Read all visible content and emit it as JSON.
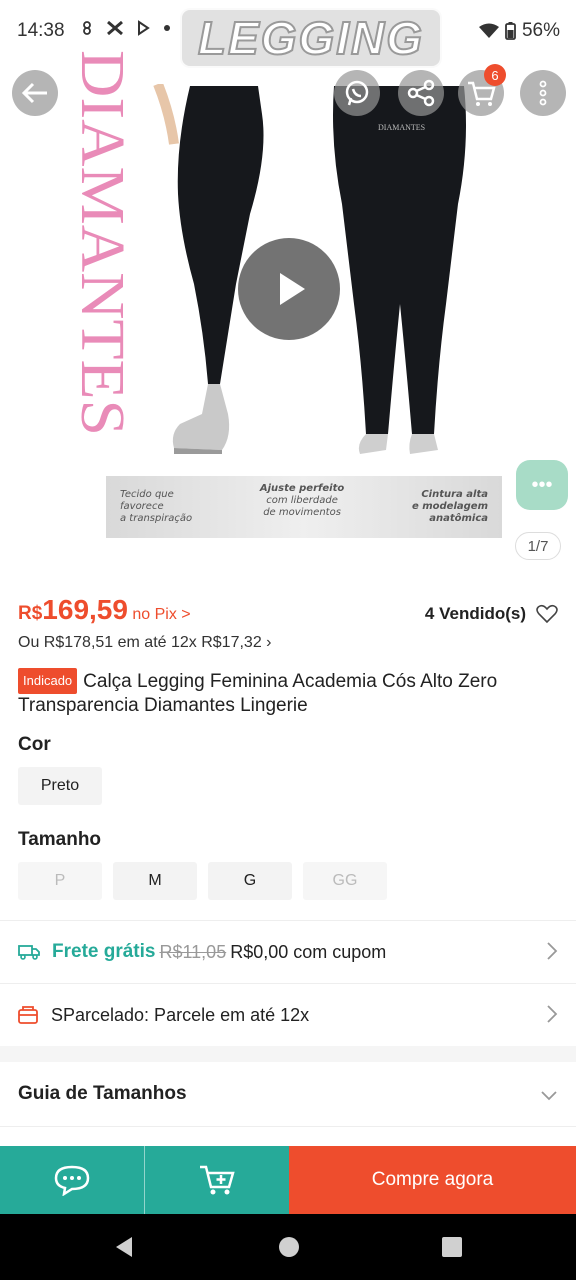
{
  "status_bar": {
    "time": "14:38",
    "battery": "56%",
    "watermark": "LEGGING"
  },
  "media": {
    "brand_text": "DIAMANTES",
    "back_waistband_text": "DIAMANTES",
    "banner": {
      "left": [
        "Tecido que",
        "favorece",
        "a transpiração"
      ],
      "middle": [
        "Ajuste perfeito",
        "com liberdade",
        "de movimentos"
      ],
      "right": [
        "Cintura alta",
        "e modelagem",
        "anatômica"
      ]
    },
    "cart_count": "6",
    "page_indicator": "1/7"
  },
  "price": {
    "currency": "R$",
    "value": "169,59",
    "pix_label": "no Pix >",
    "sold": "4 Vendido(s)",
    "installment": "Ou R$178,51 em até 12x R$17,32 ›"
  },
  "product": {
    "tag": "Indicado",
    "title": "Calça Legging Feminina Academia Cós Alto Zero Transparencia Diamantes Lingerie"
  },
  "color": {
    "label": "Cor",
    "options": [
      "Preto"
    ]
  },
  "size": {
    "label": "Tamanho",
    "options": [
      "P",
      "M",
      "G",
      "GG"
    ]
  },
  "shipping": {
    "free_label": "Frete grátis",
    "old_price": "R$11,05",
    "new_price": "R$0,00 com cupom"
  },
  "installment_row": {
    "text": "SParcelado: Parcele em até 12x"
  },
  "size_guide": {
    "label": "Guia de Tamanhos"
  },
  "actions": {
    "buy_now": "Compre agora"
  },
  "colors": {
    "accent": "#ee4d2d",
    "teal": "#26aa99"
  }
}
